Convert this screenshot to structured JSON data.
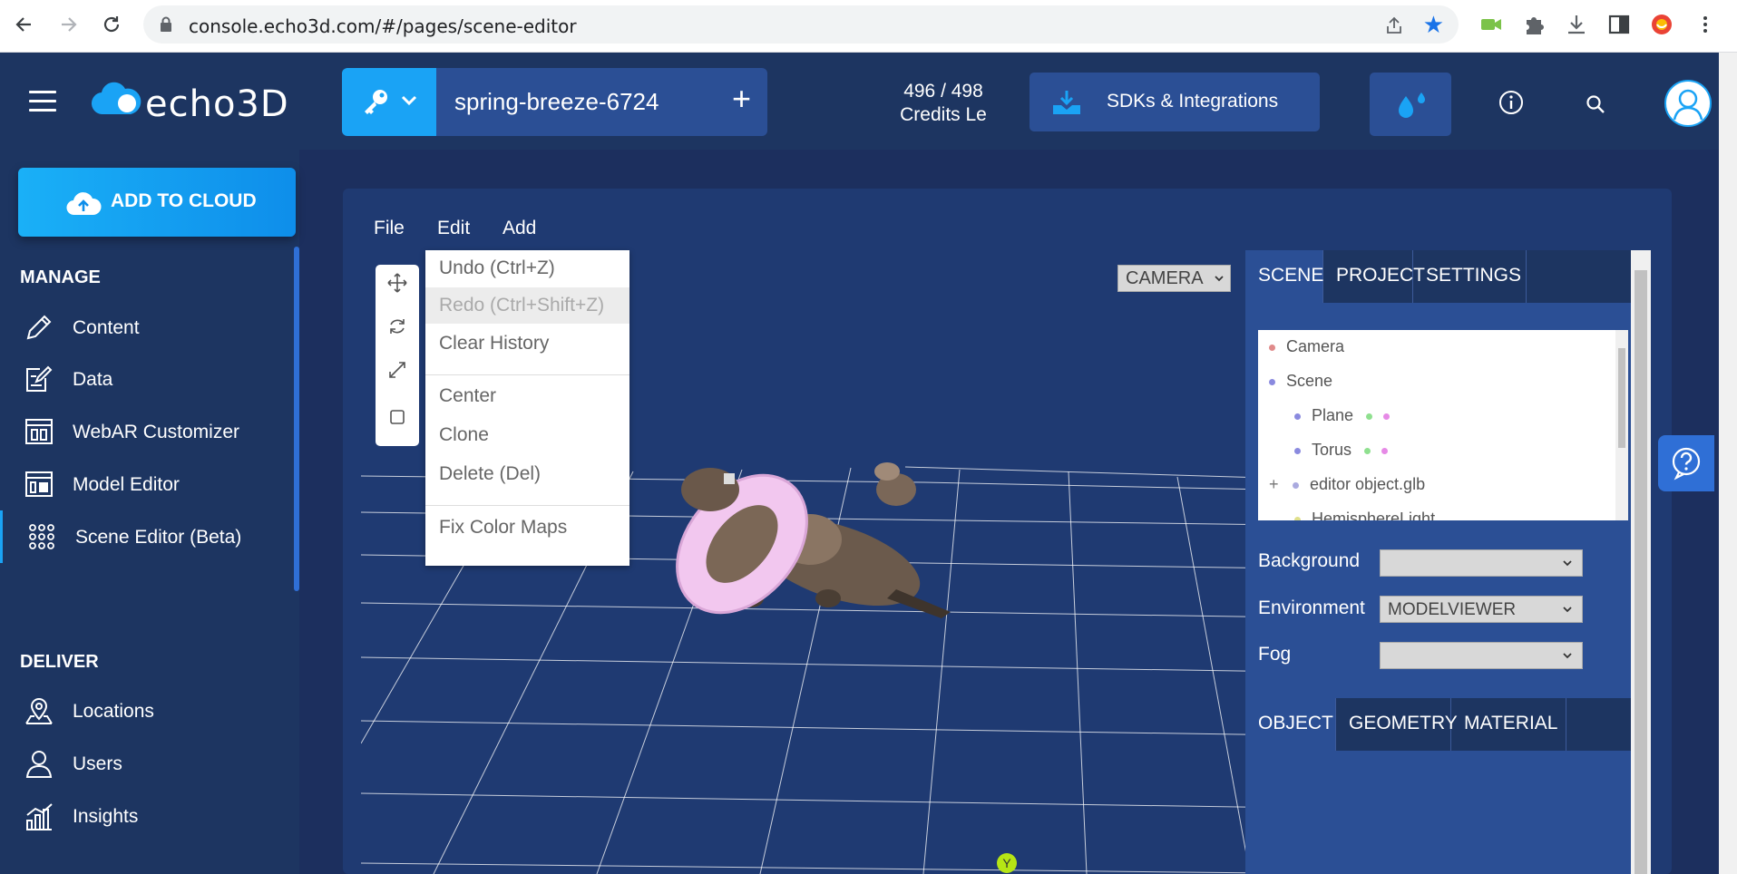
{
  "browser": {
    "url": "console.echo3d.com/#/pages/scene-editor",
    "icons": [
      "back-icon",
      "forward-icon",
      "reload-icon",
      "lock-icon",
      "share-icon",
      "star-icon",
      "extension-icons",
      "download-icon",
      "sidepanel-icon",
      "profile-icon",
      "kebab-menu-icon"
    ]
  },
  "header": {
    "brand": "echo3D",
    "project_name": "spring-breeze-6724",
    "project_add": "+",
    "credits_line1": "496 / 498",
    "credits_line2": "Credits Le",
    "sdk_label": "SDKs & Integrations"
  },
  "sidebar": {
    "add_to_cloud": "ADD TO CLOUD",
    "manage_title": "MANAGE",
    "deliver_title": "DELIVER",
    "manage_items": [
      {
        "label": "Content",
        "icon": "pencil-icon"
      },
      {
        "label": "Data",
        "icon": "edit-document-icon"
      },
      {
        "label": "WebAR Customizer",
        "icon": "webar-icon"
      },
      {
        "label": "Model Editor",
        "icon": "model-editor-icon"
      },
      {
        "label": "Scene Editor (Beta)",
        "icon": "grid-dots-icon"
      }
    ],
    "deliver_items": [
      {
        "label": "Locations",
        "icon": "location-pin-icon"
      },
      {
        "label": "Users",
        "icon": "user-icon"
      },
      {
        "label": "Insights",
        "icon": "chart-icon"
      }
    ]
  },
  "editor": {
    "menubar": [
      "File",
      "Edit",
      "Add"
    ],
    "camera_select": "CAMERA",
    "edit_menu": [
      {
        "label": "Undo (Ctrl+Z)",
        "disabled": false
      },
      {
        "label": "Redo (Ctrl+Shift+Z)",
        "disabled": true
      },
      {
        "label": "Clear History",
        "disabled": false
      },
      {
        "label": "Center",
        "disabled": false
      },
      {
        "label": "Clone",
        "disabled": false
      },
      {
        "label": "Delete (Del)",
        "disabled": false
      },
      {
        "label": "Fix Color Maps",
        "disabled": false
      }
    ],
    "axis_label": "Y"
  },
  "panel": {
    "tabs": [
      "SCENE",
      "PROJECT",
      "SETTINGS"
    ],
    "outliner": [
      {
        "label": "Camera",
        "prefix": ""
      },
      {
        "label": "Scene",
        "prefix": ""
      },
      {
        "label": "Plane",
        "prefix": ""
      },
      {
        "label": "Torus",
        "prefix": ""
      },
      {
        "label": "editor object.glb",
        "prefix": "+"
      },
      {
        "label": "HemisphereLight",
        "prefix": ""
      }
    ],
    "background_label": "Background",
    "background_value": "",
    "environment_label": "Environment",
    "environment_value": "MODELVIEWER",
    "fog_label": "Fog",
    "fog_value": "",
    "object_tabs": [
      "OBJECT",
      "GEOMETRY",
      "MATERIAL"
    ]
  },
  "colors": {
    "header_bg": "#1d3561",
    "accent": "#1aa3f5",
    "panel_bg": "#2b4f95"
  }
}
